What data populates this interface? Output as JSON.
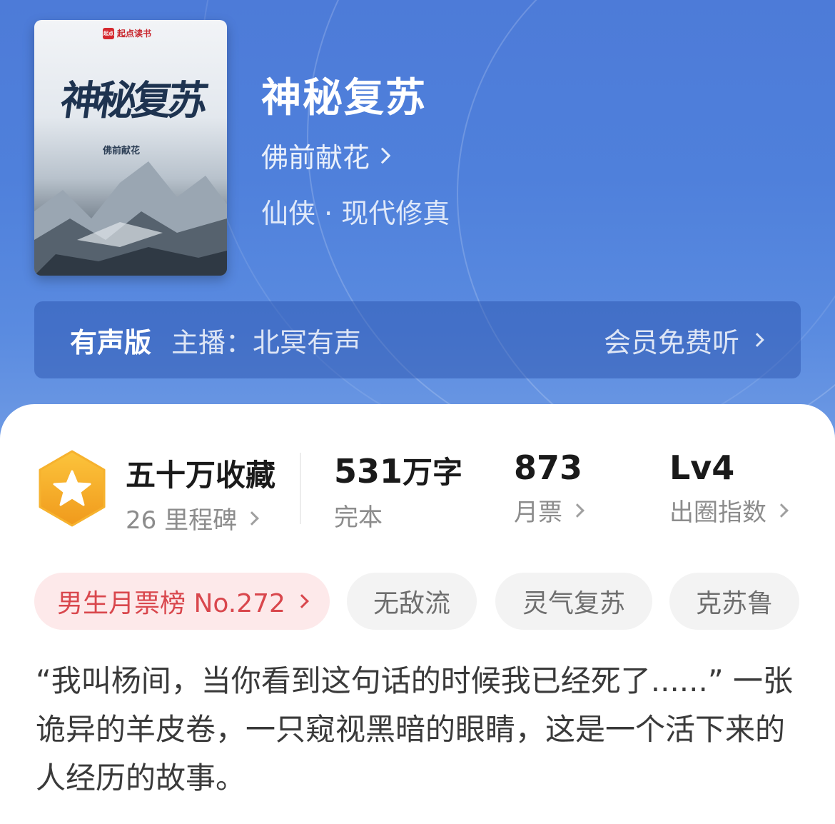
{
  "book": {
    "cover_brand": "起点读书",
    "cover_title": "神秘复苏",
    "cover_author": "佛前献花",
    "title": "神秘复苏",
    "author": "佛前献花",
    "genre": "仙侠 · 现代修真"
  },
  "audio": {
    "label": "有声版",
    "host": "主播：北冥有声",
    "action": "会员免费听"
  },
  "stats": {
    "favorites": "五十万收藏",
    "milestones": "26 里程碑",
    "words_num": "531",
    "words_unit": "万字",
    "status": "完本",
    "monthly_votes": "873",
    "monthly_votes_label": "月票",
    "level": "Lv4",
    "level_label": "出圈指数"
  },
  "tags": {
    "rank": "男生月票榜 No.272",
    "t1": "无敌流",
    "t2": "灵气复苏",
    "t3": "克苏鲁"
  },
  "description": "“我叫杨间，当你看到这句话的时候我已经死了......” 一张诡异的羊皮卷，一只窥视黑暗的眼睛，这是一个活下来的人经历的故事。",
  "colors": {
    "hero_blue": "#4f80db",
    "rank_red": "#d9474d",
    "badge_orange": "#f5a623"
  }
}
